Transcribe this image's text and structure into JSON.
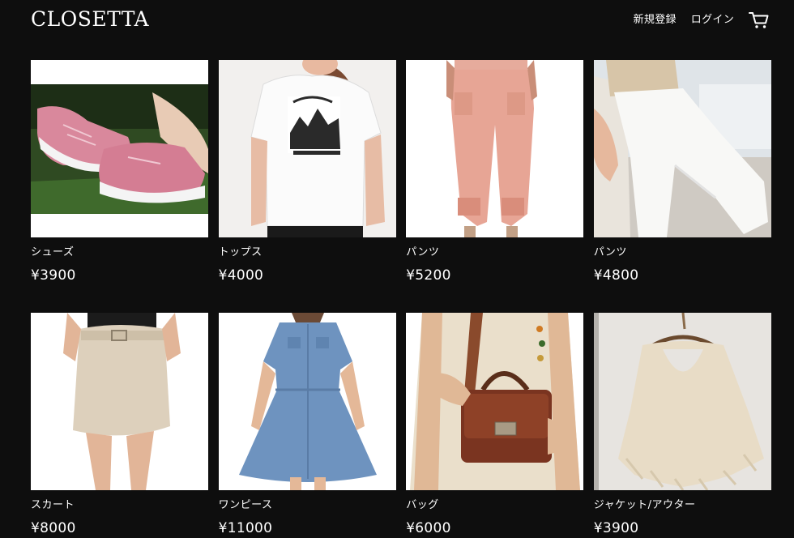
{
  "header": {
    "logo": "CLOSETTA",
    "signup_label": "新規登録",
    "login_label": "ログイン",
    "cart_icon": "cart-icon"
  },
  "products": [
    {
      "category": "シューズ",
      "price": "¥3900",
      "image": "pink-sneakers-on-grass"
    },
    {
      "category": "トップス",
      "price": "¥4000",
      "image": "white-graphic-tshirt"
    },
    {
      "category": "パンツ",
      "price": "¥5200",
      "image": "pink-jogger-pants"
    },
    {
      "category": "パンツ",
      "price": "¥4800",
      "image": "white-trousers"
    },
    {
      "category": "スカート",
      "price": "¥8000",
      "image": "beige-mini-skirt"
    },
    {
      "category": "ワンピース",
      "price": "¥11000",
      "image": "denim-shirt-dress"
    },
    {
      "category": "バッグ",
      "price": "¥6000",
      "image": "brown-croc-handbag"
    },
    {
      "category": "ジャケット/アウター",
      "price": "¥3900",
      "image": "knit-poncho-on-hanger"
    }
  ],
  "colors": {
    "background": "#0e0e0e",
    "text": "#ffffff"
  }
}
